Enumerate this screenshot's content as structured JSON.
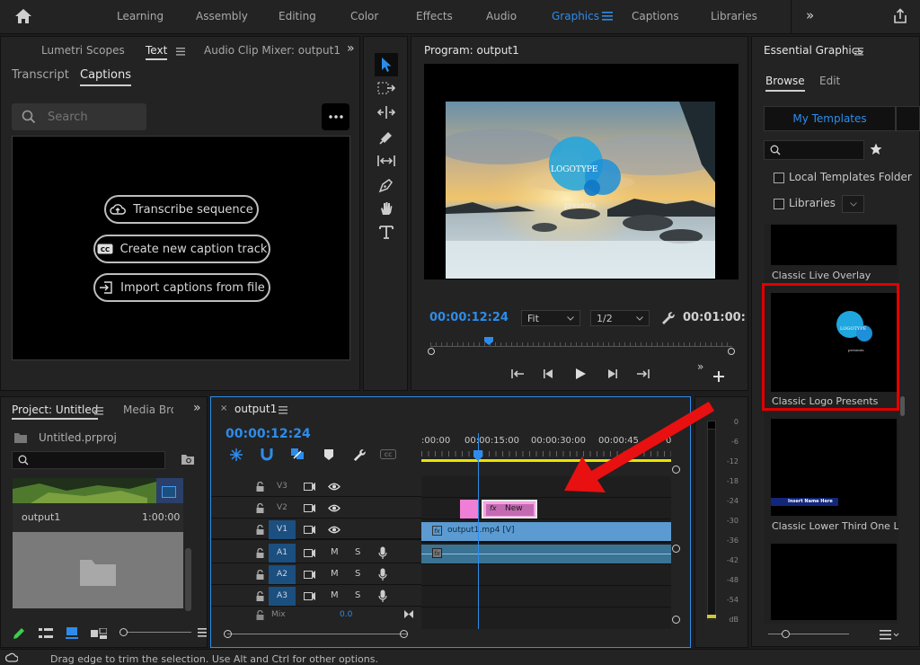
{
  "workspace": {
    "items": [
      "Learning",
      "Assembly",
      "Editing",
      "Color",
      "Effects",
      "Audio",
      "Graphics",
      "Captions",
      "Libraries"
    ],
    "active": "Graphics",
    "overflow": "»"
  },
  "left_panel": {
    "tabs": [
      "Lumetri Scopes",
      "Text",
      "Audio Clip Mixer: output1"
    ],
    "active_tab": "Text",
    "subtabs": [
      "Transcript",
      "Captions"
    ],
    "active_subtab": "Captions",
    "search_placeholder": "Search",
    "buttons": {
      "transcribe": "Transcribe sequence",
      "create_track": "Create new caption track",
      "import": "Import captions from file"
    }
  },
  "program": {
    "title": "Program: output1",
    "timecode": "00:00:12:24",
    "fit": "Fit",
    "resolution": "1/2",
    "duration": "00:01:00:",
    "overlay_logo": "LOGOTYPE",
    "overlay_sub": "presents"
  },
  "essential_graphics": {
    "title": "Essential Graphics",
    "tabs": [
      "Browse",
      "Edit"
    ],
    "active_tab": "Browse",
    "my_templates": "My Templates",
    "checkboxes": [
      "Local Templates Folder",
      "Libraries"
    ],
    "templates": [
      {
        "name": "Classic Live Overlay"
      },
      {
        "name": "Classic Logo Presents",
        "thumb_logo": "LOGOTYPE",
        "thumb_sub": "presents",
        "highlighted": true
      },
      {
        "name": "Classic Lower Third One Line",
        "thumb_text": "Insert Name Here"
      }
    ]
  },
  "project": {
    "tabs": [
      "Project: Untitled",
      "Media Brov"
    ],
    "file": "Untitled.prproj",
    "item_name": "output1",
    "item_duration": "1:00:00"
  },
  "timeline": {
    "tab": "output1",
    "timecode": "00:00:12:24",
    "ruler": [
      ":00:00",
      "00:00:15:00",
      "00:00:30:00",
      "00:00:45",
      "0"
    ],
    "video_tracks": [
      {
        "name": "V3",
        "target": false
      },
      {
        "name": "V2",
        "target": false
      },
      {
        "name": "V1",
        "target": true
      }
    ],
    "audio_tracks": [
      {
        "name": "A1"
      },
      {
        "name": "A2"
      },
      {
        "name": "A3"
      }
    ],
    "mix_label": "Mix",
    "mix_value": "0.0",
    "clips": {
      "v2_label": "New",
      "v1_label": "output1.mp4 [V]"
    },
    "track_buttons": {
      "mute": "M",
      "solo": "S"
    }
  },
  "meter": {
    "ticks": [
      "0",
      "-6",
      "-12",
      "-18",
      "-24",
      "-30",
      "-36",
      "-42",
      "-48",
      "-54",
      "dB"
    ]
  },
  "status": {
    "text": "Drag edge to trim the selection. Use Alt and Ctrl for other options."
  },
  "colors": {
    "accent": "#2d8ceb",
    "highlight_box": "#e00000",
    "arrow": "#e81010",
    "clip_pink": "#ef7fd6",
    "clip_blue": "#5b9bd1",
    "playhead": "#2d8ceb"
  }
}
